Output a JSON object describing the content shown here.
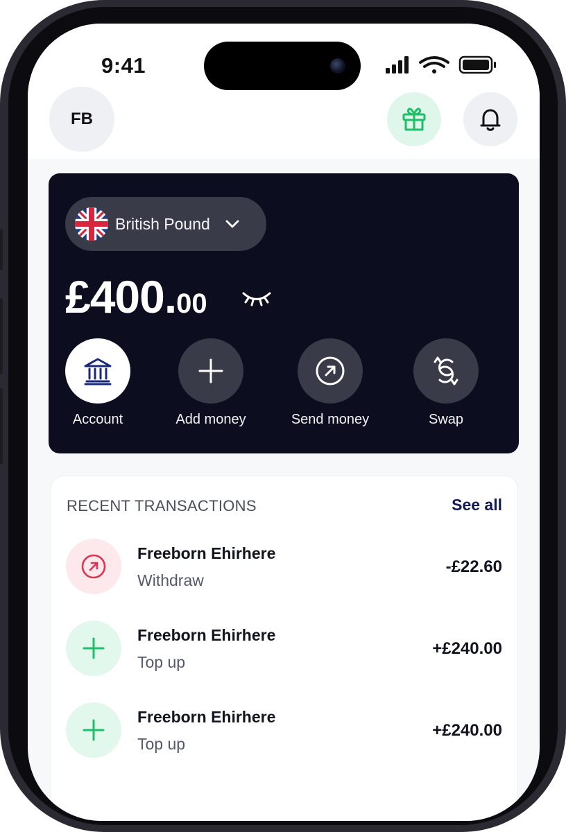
{
  "status_bar": {
    "time": "9:41"
  },
  "header": {
    "avatar_initials": "FB",
    "gift_icon": "gift-icon",
    "bell_icon": "bell-icon",
    "gift_color": "#1fbf6a"
  },
  "balance_card": {
    "currency": "British Pound",
    "currency_flag": "uk-flag-icon",
    "amount_main": "£400.",
    "amount_decimal": "00",
    "hide_icon": "closed-eye-icon",
    "background": "#0c0d1e",
    "actions": [
      {
        "label": "Account",
        "icon": "bank-icon"
      },
      {
        "label": "Add money",
        "icon": "plus-icon"
      },
      {
        "label": "Send money",
        "icon": "send-arrow-icon"
      },
      {
        "label": "Swap",
        "icon": "swap-icon"
      }
    ]
  },
  "transactions": {
    "title": "RECENT TRANSACTIONS",
    "see_all": "See all",
    "items": [
      {
        "name": "Freeborn Ehirhere",
        "type": "Withdraw",
        "amount": "-£22.60",
        "icon": "withdraw-arrow-icon",
        "color": "#e0334f"
      },
      {
        "name": "Freeborn Ehirhere",
        "type": "Top up",
        "amount": "+£240.00",
        "icon": "plus-icon",
        "color": "#1fbf6a"
      },
      {
        "name": "Freeborn Ehirhere",
        "type": "Top up",
        "amount": "+£240.00",
        "icon": "plus-icon",
        "color": "#1fbf6a"
      }
    ]
  }
}
